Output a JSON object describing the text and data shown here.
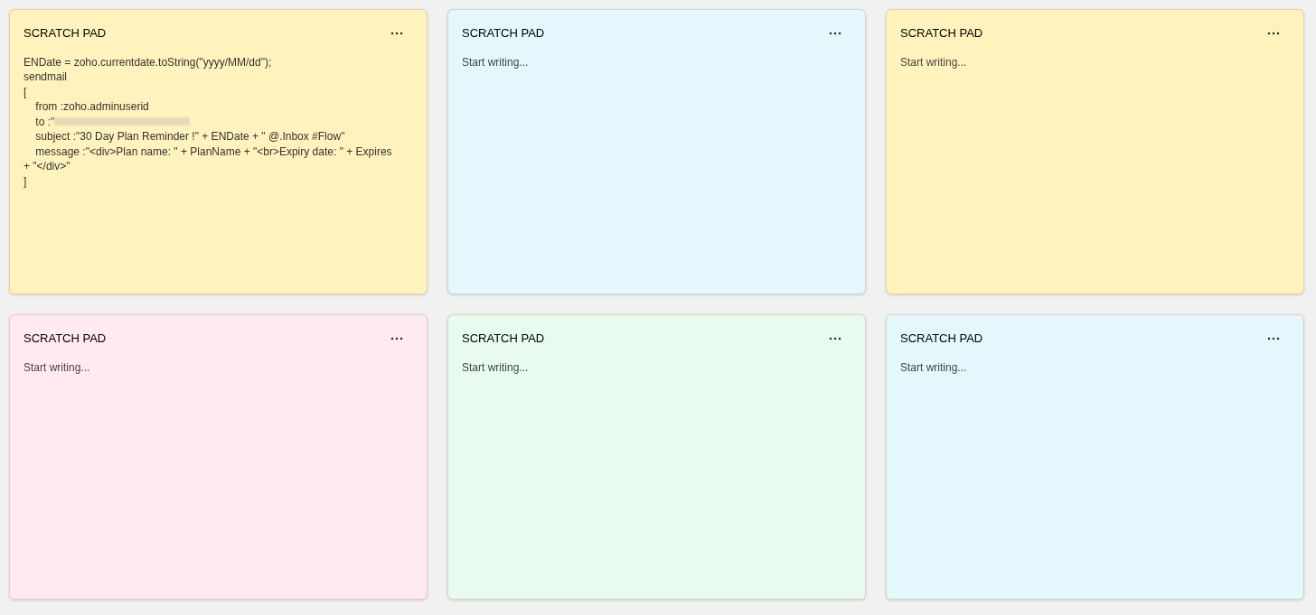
{
  "notes": [
    {
      "title": "SCRATCH PAD",
      "color": "#fff3bd",
      "lines": [
        {
          "text": "ENDate = zoho.currentdate.toString(\"yyyy/MM/dd\");"
        },
        {
          "text": "sendmail"
        },
        {
          "text": "["
        },
        {
          "text": "\tfrom :zoho.adminuserid"
        },
        {
          "text": "\tto :\"",
          "redacted": true
        },
        {
          "text": "\tsubject :\"30 Day Plan Reminder !\" + ENDate + \" @.Inbox #Flow\""
        },
        {
          "text": "\tmessage :\"<div>Plan name: \" + PlanName + \"<br>Expiry date: \" + Expires"
        },
        {
          "text": "+ \"</div>\""
        },
        {
          "text": "]"
        }
      ]
    },
    {
      "title": "SCRATCH PAD",
      "color": "#e3f7fc",
      "placeholder": "Start writing..."
    },
    {
      "title": "SCRATCH PAD",
      "color": "#fff3bd",
      "placeholder": "Start writing..."
    },
    {
      "title": "SCRATCH PAD",
      "color": "#ffebef",
      "placeholder": "Start writing..."
    },
    {
      "title": "SCRATCH PAD",
      "color": "#e7fbef",
      "placeholder": "Start writing..."
    },
    {
      "title": "SCRATCH PAD",
      "color": "#e3f7fc",
      "placeholder": "Start writing..."
    }
  ]
}
